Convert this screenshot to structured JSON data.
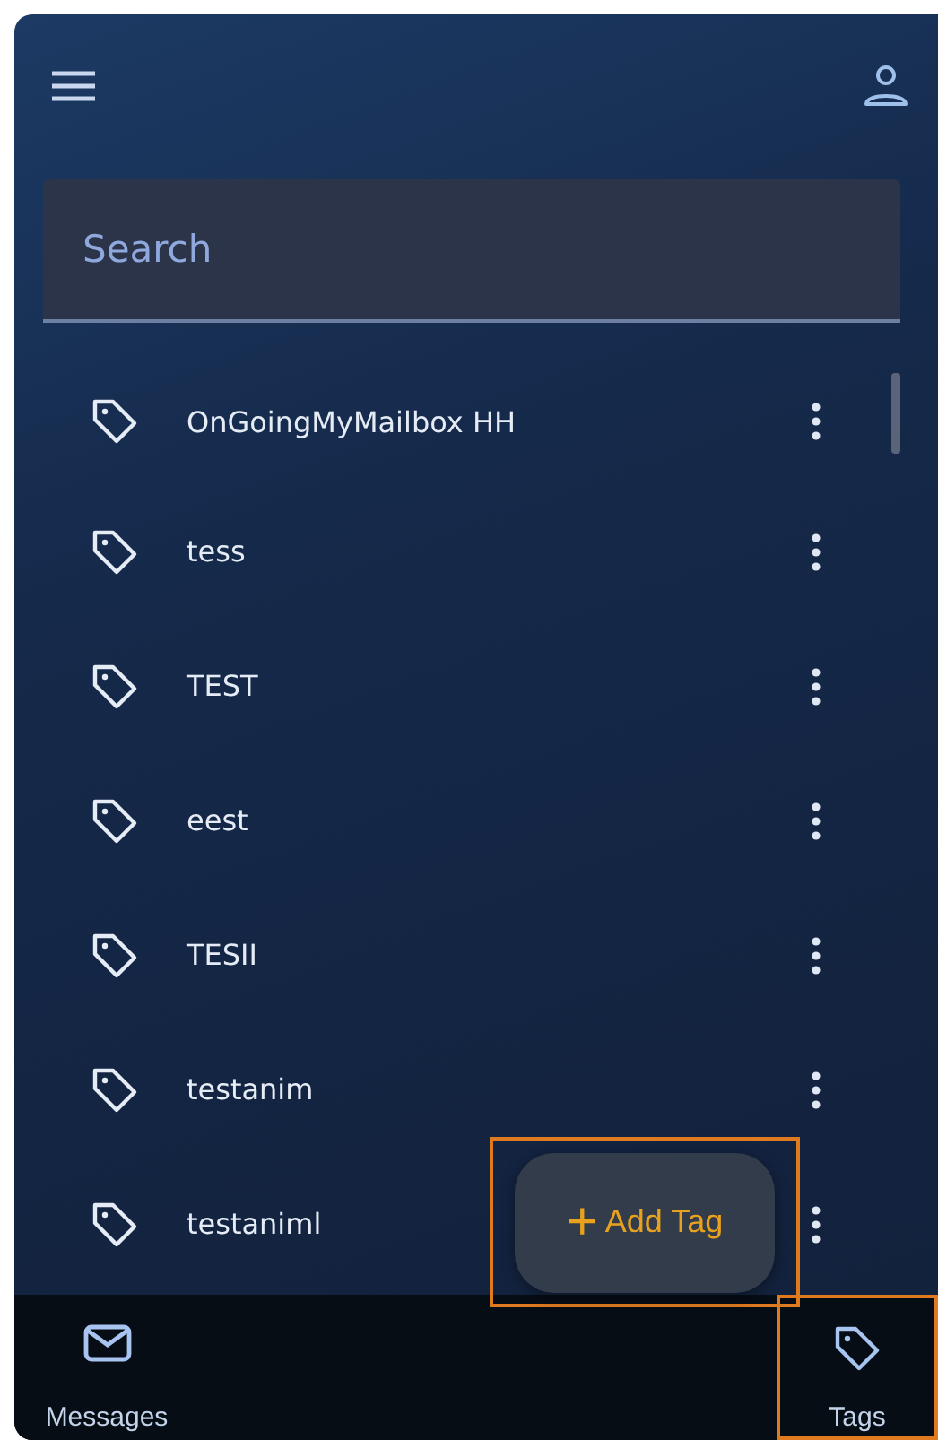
{
  "search": {
    "placeholder": "Search"
  },
  "tags": [
    {
      "label": "OnGoingMyMailbox HH"
    },
    {
      "label": "tess"
    },
    {
      "label": "TEST"
    },
    {
      "label": "eest"
    },
    {
      "label": "TESII"
    },
    {
      "label": "testanim"
    },
    {
      "label": "testaniml"
    }
  ],
  "fab": {
    "label": "Add Tag",
    "icon": "+",
    "highlighted": true
  },
  "bottom_nav": [
    {
      "label": "Messages",
      "kind": "mail",
      "highlighted": false
    },
    {
      "label": "Tags",
      "kind": "tag",
      "highlighted": true
    }
  ]
}
